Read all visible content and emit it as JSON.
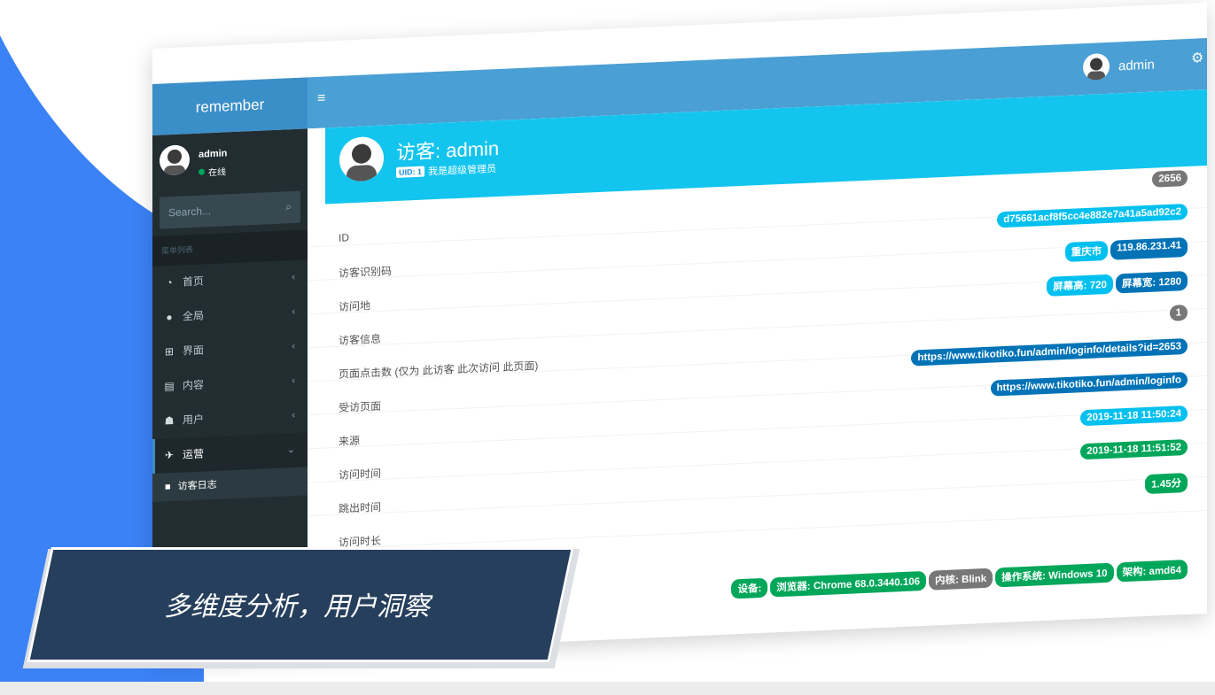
{
  "app": {
    "brand": "remember",
    "user": "admin"
  },
  "sidebar": {
    "user_name": "admin",
    "user_status": "在线",
    "search_placeholder": "Search...",
    "menu_header": "菜单列表",
    "items": [
      {
        "label": "首页",
        "icon": "dashboard-icon",
        "glyph": "◔"
      },
      {
        "label": "全局",
        "icon": "globe-icon",
        "glyph": "●"
      },
      {
        "label": "界面",
        "icon": "layout-icon",
        "glyph": "⊞"
      },
      {
        "label": "内容",
        "icon": "file-icon",
        "glyph": "▤"
      },
      {
        "label": "用户",
        "icon": "users-icon",
        "glyph": "☗"
      },
      {
        "label": "运营",
        "icon": "plane-icon",
        "glyph": "✈"
      }
    ],
    "sub_items": [
      {
        "label": "访客日志",
        "icon": "folder-icon",
        "glyph": "■"
      }
    ]
  },
  "profile": {
    "title": "访客: admin",
    "uid": "UID: 1",
    "subtitle": "我是超级管理员",
    "count": "2656"
  },
  "details": {
    "rows": [
      {
        "label": "ID",
        "values": [
          {
            "text": "d75661acf8f5cc4e882e7a41a5ad92c2",
            "color": "aqua"
          }
        ]
      },
      {
        "label": "访客识别码",
        "values": [
          {
            "text": "重庆市",
            "color": "aqua"
          },
          {
            "text": "119.86.231.41",
            "color": "blue"
          }
        ]
      },
      {
        "label": "访问地",
        "values": [
          {
            "text": "屏幕高: 720",
            "color": "aqua"
          },
          {
            "text": "屏幕宽: 1280",
            "color": "blue"
          }
        ]
      },
      {
        "label": "访客信息",
        "values": [
          {
            "text": "1",
            "color": "gray"
          }
        ]
      },
      {
        "label": "页面点击数 (仅为 此访客 此次访问 此页面)",
        "values": [
          {
            "text": "https://www.tikotiko.fun/admin/loginfo/details?id=2653",
            "color": "blue"
          }
        ]
      },
      {
        "label": "受访页面",
        "values": [
          {
            "text": "https://www.tikotiko.fun/admin/loginfo",
            "color": "blue"
          }
        ]
      },
      {
        "label": "来源",
        "values": [
          {
            "text": "2019-11-18 11:50:24",
            "color": "aqua"
          }
        ]
      },
      {
        "label": "访问时间",
        "values": [
          {
            "text": "2019-11-18 11:51:52",
            "color": "green"
          }
        ]
      },
      {
        "label": "跳出时间",
        "values": [
          {
            "text": "1.45分",
            "color": "green"
          }
        ]
      },
      {
        "label": "访问时长",
        "values": []
      }
    ],
    "device": [
      {
        "text": "设备:",
        "color": "green"
      },
      {
        "text": "浏览器: Chrome 68.0.3440.106",
        "color": "green"
      },
      {
        "text": "内核: Blink",
        "color": "gray"
      },
      {
        "text": "操作系统: Windows 10",
        "color": "green"
      },
      {
        "text": "架构: amd64",
        "color": "green"
      }
    ]
  },
  "banner": {
    "text": "多维度分析，用户洞察"
  },
  "colors": {
    "aqua": "#00c0ef",
    "blue": "#0073b7",
    "green": "#00a65a",
    "gray": "#777777",
    "sidebar_bg": "#222d32",
    "header_blue": "#4a9fd4",
    "hero_cyan": "#13c5ee",
    "banner_navy": "#263f5c",
    "blob_blue": "#3b82f6"
  }
}
